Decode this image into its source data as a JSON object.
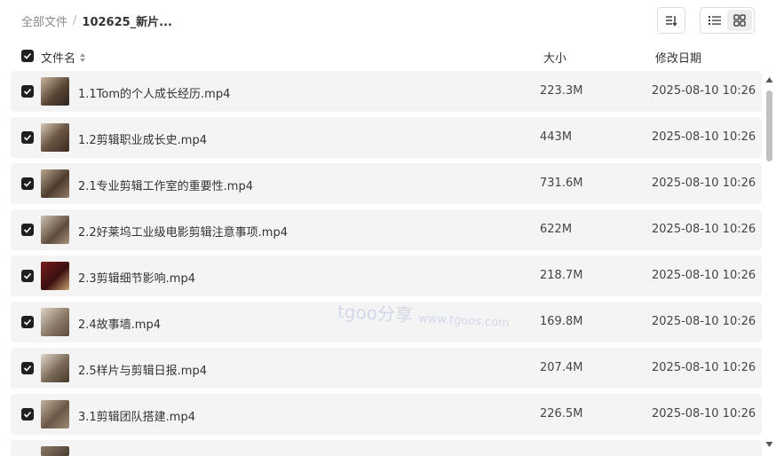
{
  "breadcrumb": {
    "root": "全部文件",
    "separator": "/",
    "current": "102625_新片..."
  },
  "toolbar": {
    "sort_icon": "sort-icon",
    "list_view_icon": "list-view-icon",
    "grid_view_icon": "grid-view-icon",
    "active_view": "list"
  },
  "header": {
    "name": "文件名",
    "size": "大小",
    "date": "修改日期"
  },
  "files": [
    {
      "name": "1.1Tom的个人成长经历.mp4",
      "size": "223.3M",
      "date": "2025-08-10 10:26",
      "checked": true
    },
    {
      "name": "1.2剪辑职业成长史.mp4",
      "size": "443M",
      "date": "2025-08-10 10:26",
      "checked": true
    },
    {
      "name": "2.1专业剪辑工作室的重要性.mp4",
      "size": "731.6M",
      "date": "2025-08-10 10:26",
      "checked": true
    },
    {
      "name": "2.2好莱坞工业级电影剪辑注意事项.mp4",
      "size": "622M",
      "date": "2025-08-10 10:26",
      "checked": true
    },
    {
      "name": "2.3剪辑细节影响.mp4",
      "size": "218.7M",
      "date": "2025-08-10 10:26",
      "checked": true
    },
    {
      "name": "2.4故事墙.mp4",
      "size": "169.8M",
      "date": "2025-08-10 10:26",
      "checked": true
    },
    {
      "name": "2.5样片与剪辑日报.mp4",
      "size": "207.4M",
      "date": "2025-08-10 10:26",
      "checked": true
    },
    {
      "name": "3.1剪辑团队搭建.mp4",
      "size": "226.5M",
      "date": "2025-08-10 10:26",
      "checked": true
    }
  ],
  "watermark": {
    "brand": "tgoo分享",
    "url": "www.tgoos.com"
  },
  "colors": {
    "row_bg": "#f4f4f4",
    "checkbox": "#1f1f1f",
    "text": "#333333",
    "muted": "#8a8a8a"
  }
}
